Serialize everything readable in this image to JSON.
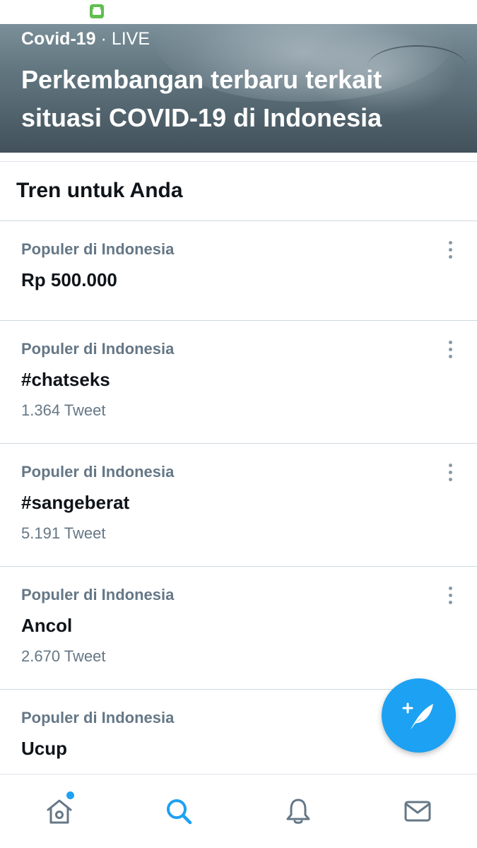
{
  "hero": {
    "category": "Covid-19",
    "separator": " · ",
    "live_label": "LIVE",
    "title": "Perkembangan terbaru terkait situasi COVID-19 di Indonesia"
  },
  "section": {
    "title": "Tren untuk Anda"
  },
  "trends": [
    {
      "context": "Populer di Indonesia",
      "name": "Rp 500.000",
      "count": ""
    },
    {
      "context": "Populer di Indonesia",
      "name": "#chatseks",
      "count": "1.364 Tweet"
    },
    {
      "context": "Populer di Indonesia",
      "name": "#sangeberat",
      "count": "5.191 Tweet"
    },
    {
      "context": "Populer di Indonesia",
      "name": "Ancol",
      "count": "2.670 Tweet"
    },
    {
      "context": "Populer di Indonesia",
      "name": "Ucup",
      "count": ""
    }
  ],
  "icons": {
    "fab": "compose-tweet-icon",
    "nav": [
      "home-icon",
      "search-icon",
      "notifications-bell-icon",
      "messages-envelope-icon"
    ]
  },
  "colors": {
    "accent": "#1da1f2",
    "secondary_text": "#657786",
    "primary_text": "#0f1419",
    "active_nav": "#1da1f2",
    "inactive_nav": "#657786"
  },
  "nav": {
    "active": "search",
    "home_has_notification_dot": true
  }
}
